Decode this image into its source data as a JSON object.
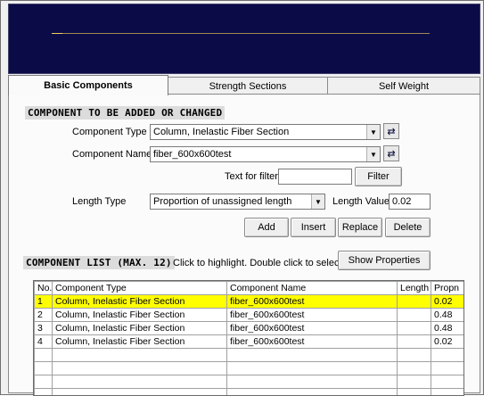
{
  "tabs": [
    {
      "label": "Basic Components",
      "active": true
    },
    {
      "label": "Strength Sections",
      "active": false
    },
    {
      "label": "Self Weight",
      "active": false
    }
  ],
  "component_section": {
    "title": "COMPONENT TO BE ADDED OR CHANGED",
    "component_type_label": "Component Type",
    "component_type_value": "Column, Inelastic Fiber Section",
    "component_name_label": "Component Name",
    "component_name_value": "fiber_600x600test",
    "filter_label": "Text for filter",
    "filter_value": "",
    "filter_button": "Filter",
    "length_type_label": "Length Type",
    "length_type_value": "Proportion of unassigned length",
    "length_value_label": "Length Value",
    "length_value": "0.02",
    "buttons": {
      "add": "Add",
      "insert": "Insert",
      "replace": "Replace",
      "delete": "Delete"
    }
  },
  "component_list": {
    "title": "COMPONENT LIST (MAX. 12)",
    "hint": "Click to highlight.  Double click to select.",
    "show_properties": "Show Properties",
    "columns": [
      "No.",
      "Component Type",
      "Component Name",
      "Length",
      "Propn"
    ],
    "rows": [
      {
        "no": "1",
        "type": "Column, Inelastic Fiber Section",
        "name": "fiber_600x600test",
        "length": "",
        "propn": "0.02",
        "highlighted": true
      },
      {
        "no": "2",
        "type": "Column, Inelastic Fiber Section",
        "name": "fiber_600x600test",
        "length": "",
        "propn": "0.48",
        "highlighted": false
      },
      {
        "no": "3",
        "type": "Column, Inelastic Fiber Section",
        "name": "fiber_600x600test",
        "length": "",
        "propn": "0.48",
        "highlighted": false
      },
      {
        "no": "4",
        "type": "Column, Inelastic Fiber Section",
        "name": "fiber_600x600test",
        "length": "",
        "propn": "0.02",
        "highlighted": false
      }
    ],
    "empty_rows": 4
  },
  "colors": {
    "highlight": "#ffff00",
    "preview_bg": "#0b0b48"
  }
}
